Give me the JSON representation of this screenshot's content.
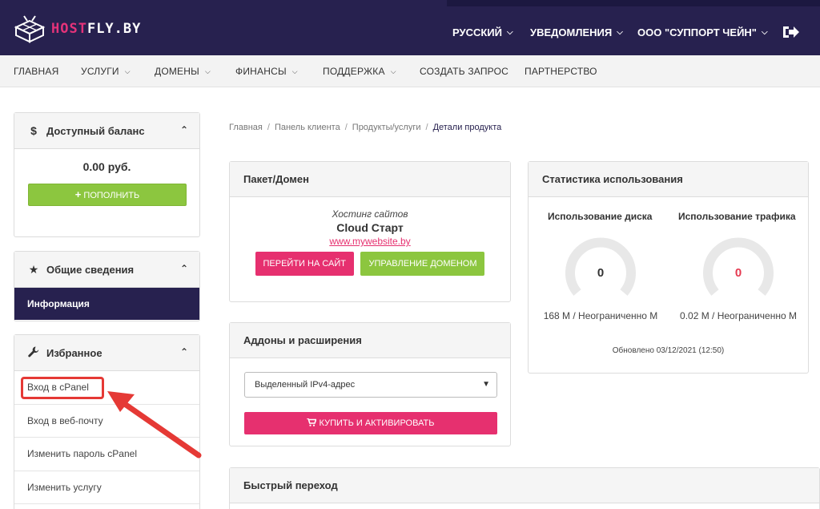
{
  "header": {
    "logo_host": "HOST",
    "logo_fly": "FLY.BY",
    "language": "РУССКИЙ",
    "notifications": "УВЕДОМЛЕНИЯ",
    "company": "ООО \"СУППОРТ ЧЕЙН\""
  },
  "nav": {
    "items": [
      "ГЛАВНАЯ",
      "УСЛУГИ",
      "ДОМЕНЫ",
      "ФИНАНСЫ",
      "ПОДДЕРЖКА",
      "СОЗДАТЬ ЗАПРОС",
      "ПАРТНЕРСТВО"
    ]
  },
  "sidebar": {
    "balance_title": "Доступный баланс",
    "balance_icon": "$",
    "balance_value": "0.00 руб.",
    "topup_button": "ПОПОЛНИТЬ",
    "general_title": "Общие сведения",
    "info_item": "Информация",
    "favorites_title": "Избранное",
    "favorites": [
      "Вход в cPanel",
      "Вход в веб-почту",
      "Изменить пароль cPanel",
      "Изменить услугу"
    ]
  },
  "breadcrumb": [
    "Главная",
    "Панель клиента",
    "Продукты/услуги",
    "Детали продукта"
  ],
  "package": {
    "title": "Пакет/Домен",
    "group": "Хостинг сайтов",
    "name": "Cloud Старт",
    "domain": "www.mywebsite.by",
    "visit_button": "ПЕРЕЙТИ НА САЙТ",
    "manage_button": "УПРАВЛЕНИЕ ДОМЕНОМ"
  },
  "addons": {
    "title": "Аддоны и расширения",
    "selected_option": "Выделенный IPv4-адрес",
    "buy_button": "КУПИТЬ И АКТИВИРОВАТЬ"
  },
  "stats": {
    "title": "Статистика использования",
    "disk_title": "Использование диска",
    "disk_value": "0",
    "disk_usage": "168 М / Неограниченно М",
    "traffic_title": "Использование трафика",
    "traffic_value": "0",
    "traffic_usage": "0.02 М / Неограниченно М",
    "updated": "Обновлено 03/12/2021 (12:50)"
  },
  "quick": {
    "title": "Быстрый переход"
  },
  "colors": {
    "header_bg": "#27214f",
    "brand_pink": "#e6306f",
    "green": "#8cc63f",
    "annotation_red": "#e53935"
  },
  "icons": {
    "logout": "logout-icon",
    "cart": "cart-icon",
    "star": "star-icon",
    "wrench": "wrench-icon"
  }
}
